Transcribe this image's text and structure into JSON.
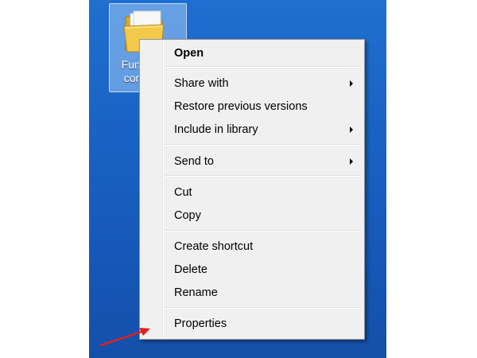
{
  "desktop": {
    "icon": {
      "label": "FunT\ncom",
      "icon": "folder-icon"
    },
    "background_color": "#1a63c4"
  },
  "context_menu": {
    "items": [
      {
        "label": "Open",
        "bold": true,
        "submenu": false
      },
      {
        "label": "Share with",
        "bold": false,
        "submenu": true
      },
      {
        "label": "Restore previous versions",
        "bold": false,
        "submenu": false
      },
      {
        "label": "Include in library",
        "bold": false,
        "submenu": true
      },
      {
        "label": "Send to",
        "bold": false,
        "submenu": true
      },
      {
        "label": "Cut",
        "bold": false,
        "submenu": false
      },
      {
        "label": "Copy",
        "bold": false,
        "submenu": false
      },
      {
        "label": "Create shortcut",
        "bold": false,
        "submenu": false
      },
      {
        "label": "Delete",
        "bold": false,
        "submenu": false
      },
      {
        "label": "Rename",
        "bold": false,
        "submenu": false
      },
      {
        "label": "Properties",
        "bold": false,
        "submenu": false
      }
    ]
  },
  "annotation": {
    "icon": "red-arrow-icon",
    "color": "#e02020"
  }
}
